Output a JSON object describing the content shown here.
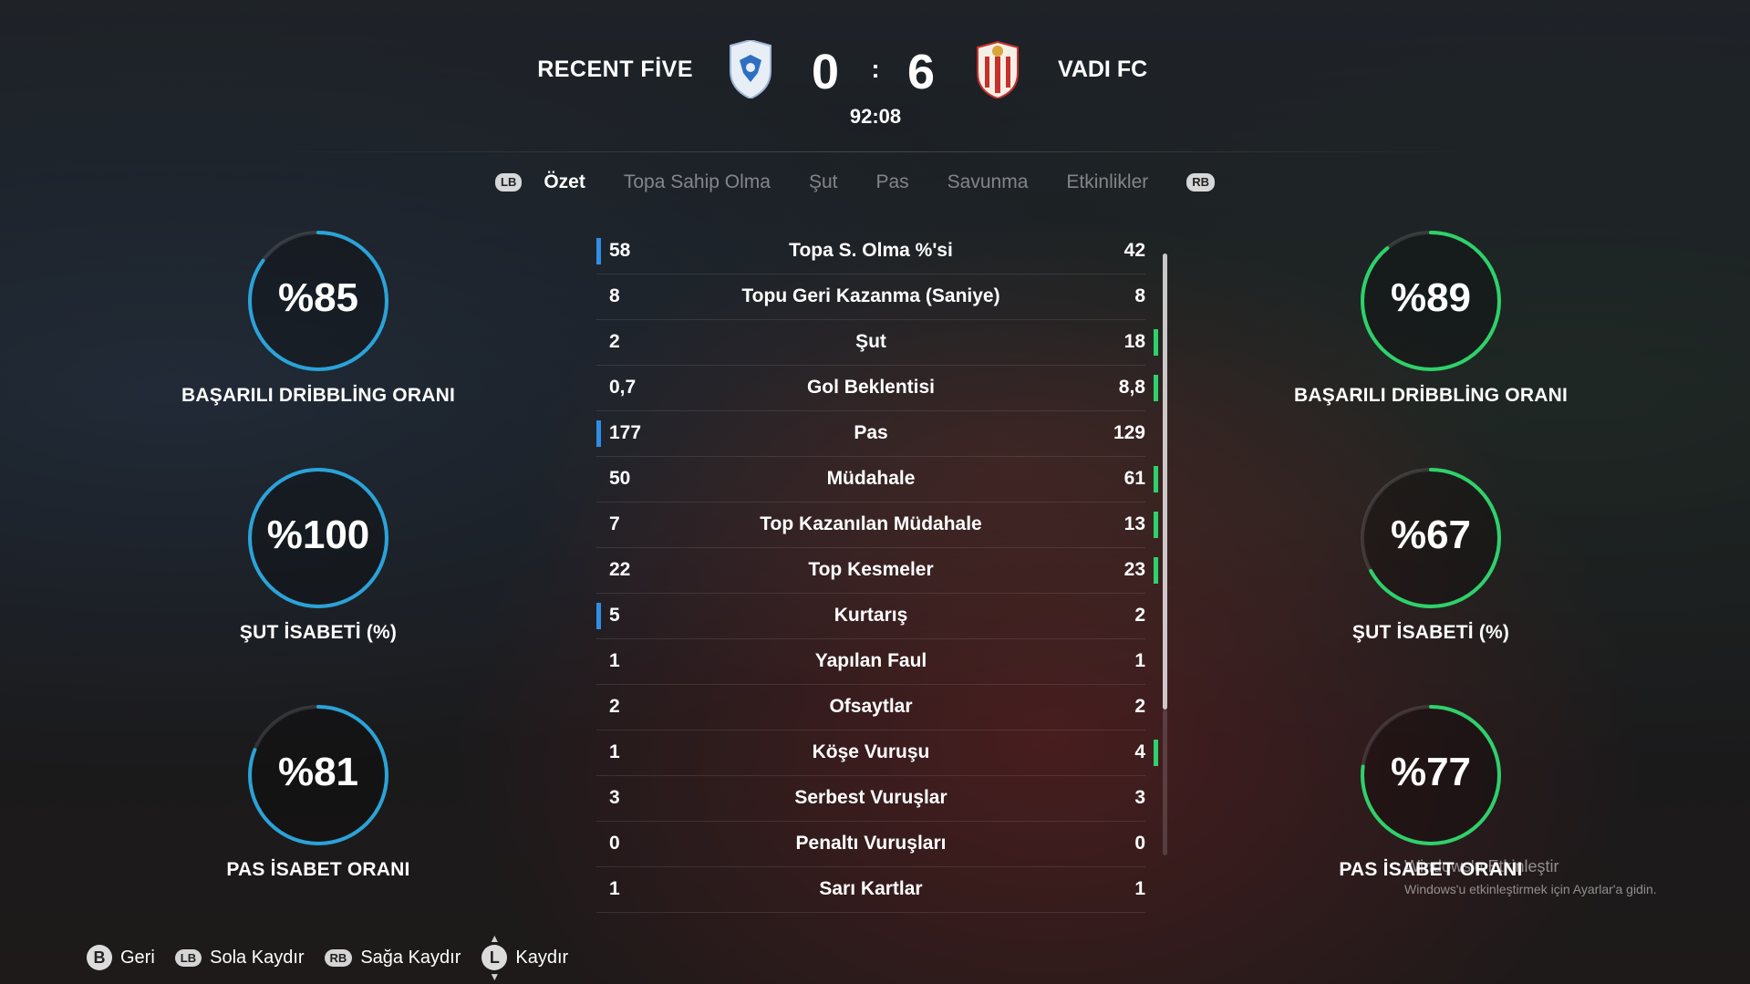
{
  "header": {
    "home_team": "RECENT FİVE",
    "away_team": "VADI FC",
    "home_score": "0",
    "separator": ":",
    "away_score": "6",
    "clock": "92:08"
  },
  "tabs": {
    "lb": "LB",
    "rb": "RB",
    "items": [
      "Özet",
      "Topa Sahip Olma",
      "Şut",
      "Pas",
      "Savunma",
      "Etkinlikler"
    ],
    "active": "Özet"
  },
  "stats": [
    {
      "label": "Topa S. Olma %'si",
      "home": "58",
      "away": "42",
      "lead": "home"
    },
    {
      "label": "Topu Geri Kazanma (Saniye)",
      "home": "8",
      "away": "8",
      "lead": "none"
    },
    {
      "label": "Şut",
      "home": "2",
      "away": "18",
      "lead": "away"
    },
    {
      "label": "Gol Beklentisi",
      "home": "0,7",
      "away": "8,8",
      "lead": "away"
    },
    {
      "label": "Pas",
      "home": "177",
      "away": "129",
      "lead": "home"
    },
    {
      "label": "Müdahale",
      "home": "50",
      "away": "61",
      "lead": "away"
    },
    {
      "label": "Top Kazanılan Müdahale",
      "home": "7",
      "away": "13",
      "lead": "away"
    },
    {
      "label": "Top Kesmeler",
      "home": "22",
      "away": "23",
      "lead": "away"
    },
    {
      "label": "Kurtarış",
      "home": "5",
      "away": "2",
      "lead": "home"
    },
    {
      "label": "Yapılan Faul",
      "home": "1",
      "away": "1",
      "lead": "none"
    },
    {
      "label": "Ofsaytlar",
      "home": "2",
      "away": "2",
      "lead": "none"
    },
    {
      "label": "Köşe Vuruşu",
      "home": "1",
      "away": "4",
      "lead": "away"
    },
    {
      "label": "Serbest Vuruşlar",
      "home": "3",
      "away": "3",
      "lead": "none"
    },
    {
      "label": "Penaltı Vuruşları",
      "home": "0",
      "away": "0",
      "lead": "none"
    },
    {
      "label": "Sarı Kartlar",
      "home": "1",
      "away": "1",
      "lead": "none"
    }
  ],
  "gauges": {
    "home": [
      {
        "value": "%85",
        "fraction": 0.85,
        "label": "BAŞARILI DRİBBLİNG ORANI"
      },
      {
        "value": "%100",
        "fraction": 1.0,
        "label": "ŞUT İSABETİ (%)"
      },
      {
        "value": "%81",
        "fraction": 0.81,
        "label": "PAS İSABET ORANI"
      }
    ],
    "away": [
      {
        "value": "%89",
        "fraction": 0.89,
        "label": "BAŞARILI DRİBBLİNG ORANI"
      },
      {
        "value": "%67",
        "fraction": 0.67,
        "label": "ŞUT İSABETİ (%)"
      },
      {
        "value": "%77",
        "fraction": 0.77,
        "label": "PAS İSABET ORANI"
      }
    ]
  },
  "colors": {
    "home_accent": "#2f8fe6",
    "away_accent": "#2ed16a",
    "home_ring": "#2aa3d8",
    "away_ring": "#2ed16a"
  },
  "footer": {
    "back_key": "B",
    "back_label": "Geri",
    "left_key": "LB",
    "left_label": "Sola Kaydır",
    "right_key": "RB",
    "right_label": "Sağa Kaydır",
    "scroll_key": "L",
    "scroll_label": "Kaydır"
  },
  "watermark": {
    "line1": "Windows'u Etkinleştir",
    "line2": "Windows'u etkinleştirmek için Ayarlar'a gidin."
  }
}
